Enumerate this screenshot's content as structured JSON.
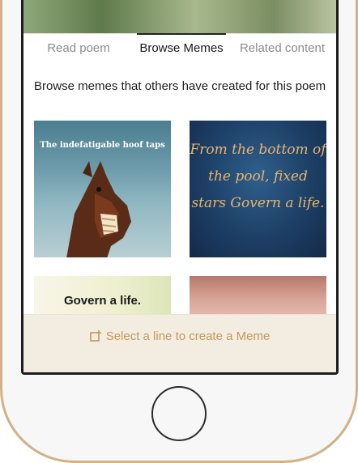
{
  "tabs": [
    {
      "label": "Read poem"
    },
    {
      "label": "Browse Memes"
    },
    {
      "label": "Related content"
    }
  ],
  "intro": "Browse memes that others have created for this poem",
  "memes": [
    {
      "text": "The indefatigable hoof taps"
    },
    {
      "text": "From the bottom of the pool, fixed stars Govern a life."
    },
    {
      "text": "Govern a life."
    },
    {
      "text": ""
    }
  ],
  "cta": {
    "label": "Select a line to create a Meme",
    "icon": "create-meme-icon"
  },
  "colors": {
    "accent": "#c3985b",
    "bottom_bar": "#f3ece1",
    "frame": "#d2b188"
  }
}
